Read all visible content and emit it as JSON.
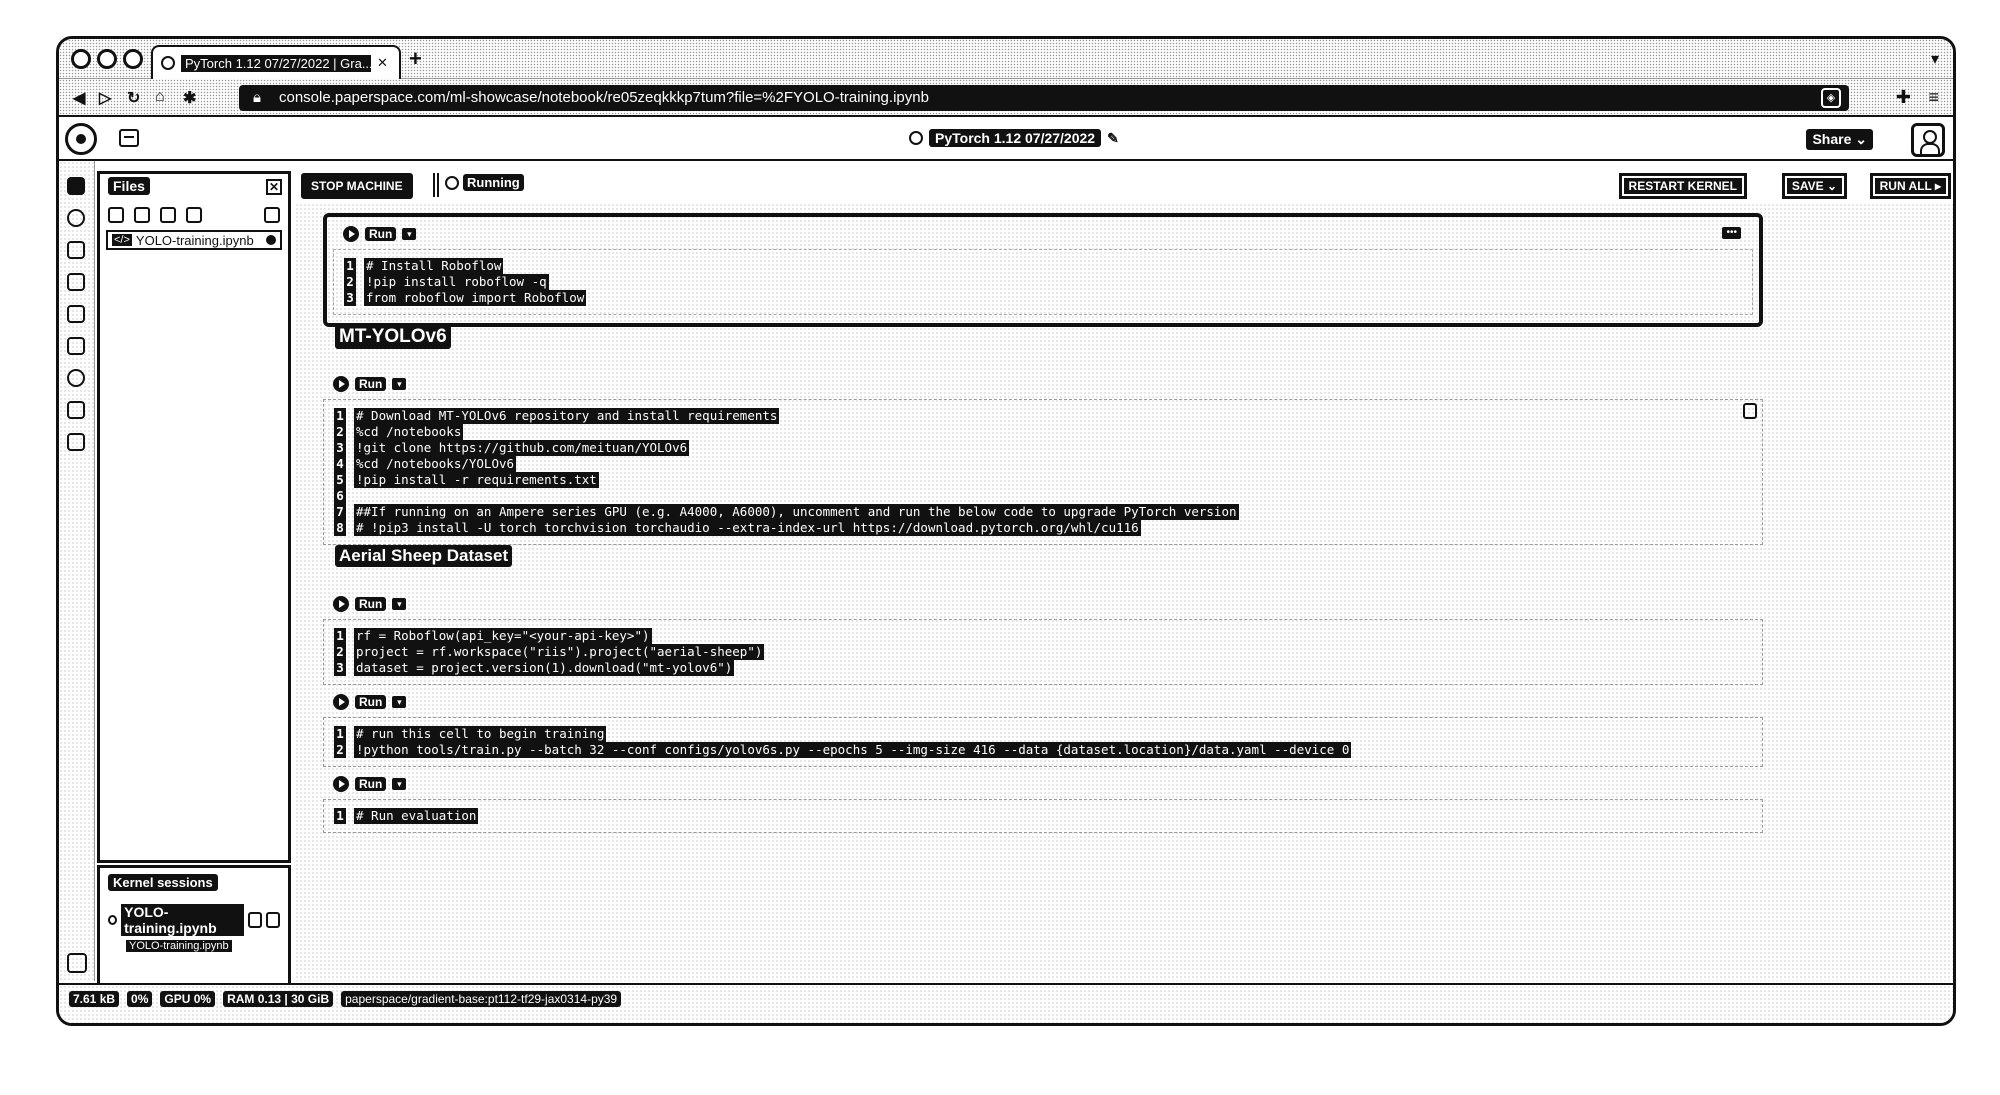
{
  "browser": {
    "tab_title": "PyTorch 1.12 07/27/2022 | Gra...",
    "new_tab": "+",
    "url": "console.paperspace.com/ml-showcase/notebook/re05zeqkkkp7tum?file=%2FYOLO-training.ipynb"
  },
  "app": {
    "notebook_title": "PyTorch 1.12 07/27/2022",
    "share_label": "Share"
  },
  "files_panel": {
    "title": "Files",
    "items": [
      {
        "icon": "</>",
        "name": "YOLO-training.ipynb"
      }
    ]
  },
  "kernel_sessions": {
    "title": "Kernel sessions",
    "session_name": "YOLO-training.ipynb",
    "session_sub": "YOLO-training.ipynb"
  },
  "toolbar": {
    "stop_label": "STOP MACHINE",
    "status_label": "Running",
    "restart_label": "RESTART KERNEL",
    "save_label": "SAVE",
    "run_all_label": "RUN ALL"
  },
  "cells": {
    "run_label": "Run",
    "c1": [
      "# Install Roboflow",
      "!pip install roboflow -q",
      "from roboflow import Roboflow"
    ],
    "h1": "MT-YOLOv6",
    "c2": [
      "# Download MT-YOLOv6 repository and install requirements",
      "%cd /notebooks",
      "!git clone https://github.com/meituan/YOLOv6",
      "%cd /notebooks/YOLOv6",
      "!pip install -r requirements.txt",
      "",
      "##If running on an Ampere series GPU (e.g. A4000, A6000), uncomment and run the below code to upgrade PyTorch version",
      "# !pip3 install -U torch torchvision torchaudio --extra-index-url https://download.pytorch.org/whl/cu116"
    ],
    "h2": "Aerial Sheep Dataset",
    "c3": [
      "rf = Roboflow(api_key=\"<your-api-key>\")",
      "project = rf.workspace(\"riis\").project(\"aerial-sheep\")",
      "dataset = project.version(1).download(\"mt-yolov6\")"
    ],
    "c4": [
      "# run this cell to begin training",
      "!python tools/train.py --batch 32 --conf configs/yolov6s.py --epochs 5 --img-size 416 --data {dataset.location}/data.yaml --device 0"
    ],
    "c5": [
      "# Run evaluation"
    ]
  },
  "statusbar": {
    "disk": "7.61 kB",
    "cpu": "0%",
    "gpu": "GPU 0%",
    "ram": "RAM 0.13 | 30 GiB",
    "env": "paperspace/gradient-base:pt112-tf29-jax0314-py39"
  }
}
